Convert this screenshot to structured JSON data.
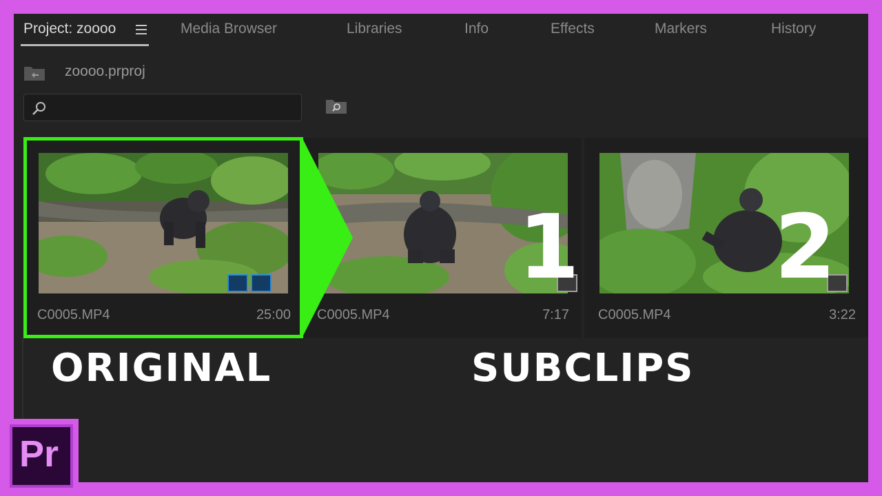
{
  "tabs": [
    {
      "label": "Project: zoooo",
      "active": true
    },
    {
      "label": "Media Browser"
    },
    {
      "label": "Libraries"
    },
    {
      "label": "Info"
    },
    {
      "label": "Effects"
    },
    {
      "label": "Markers"
    },
    {
      "label": "History"
    }
  ],
  "project": {
    "path": "zoooo.prproj"
  },
  "search": {
    "value": "",
    "placeholder": ""
  },
  "clips": [
    {
      "name": "C0005.MP4",
      "duration": "25:00"
    },
    {
      "name": "C0005.MP4",
      "duration": "7:17",
      "number": "1"
    },
    {
      "name": "C0005.MP4",
      "duration": "3:22",
      "number": "2"
    }
  ],
  "captions": {
    "left": "ORIGINAL",
    "right": "SUBCLIPS"
  },
  "logo": {
    "text": "Pr"
  },
  "colors": {
    "accent_green": "#38ee14",
    "frame_purple": "#d65ae8",
    "panel_bg": "#232323"
  }
}
